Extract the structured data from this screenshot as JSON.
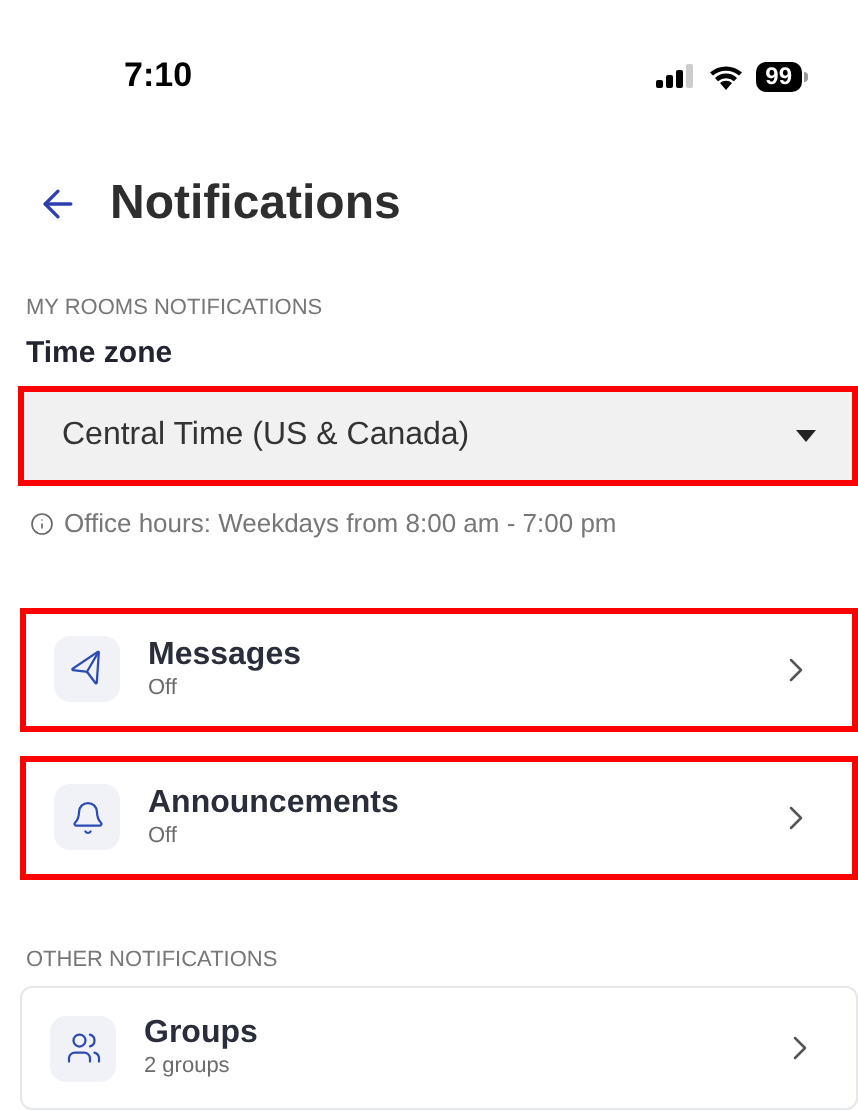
{
  "status_bar": {
    "time": "7:10",
    "battery": "99"
  },
  "header": {
    "title": "Notifications"
  },
  "my_rooms": {
    "section_label": "MY ROOMS NOTIFICATIONS",
    "field_label": "Time zone",
    "select": {
      "value": "Central Time (US & Canada)",
      "highlighted": true
    },
    "info": "Office hours: Weekdays from 8:00 am - 7:00 pm",
    "items": [
      {
        "kind": "send",
        "title": "Messages",
        "subtitle": "Off",
        "highlighted": true
      },
      {
        "kind": "bell",
        "title": "Announcements",
        "subtitle": "Off",
        "highlighted": true
      }
    ]
  },
  "other": {
    "section_label": "OTHER NOTIFICATIONS",
    "items": [
      {
        "kind": "people",
        "title": "Groups",
        "subtitle": "2 groups",
        "highlighted": false
      }
    ]
  }
}
